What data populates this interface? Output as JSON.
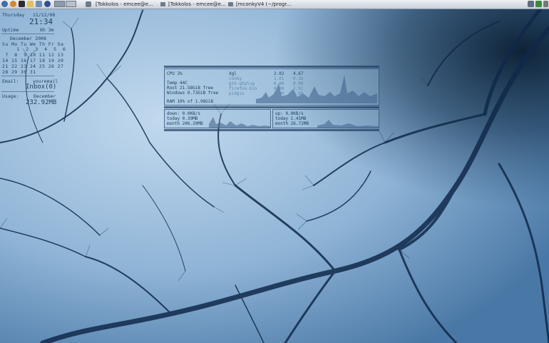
{
  "panel": {
    "tasks": [
      {
        "label": "[Tokkolos - emcee@e..."
      },
      {
        "label": "[Tokkolos - emcee@e..."
      },
      {
        "label": "[mconkyV4 (~/progr..."
      }
    ]
  },
  "conky_left": {
    "day": "Thursday",
    "date": "11/12/08",
    "time": "21:34",
    "uptime_label": "Uptime",
    "uptime_value": "6h 3m",
    "calendar": {
      "month": "December 2008",
      "header": "Su Mo Tu We Th Fr Sa",
      "weeks": [
        " 1  2  3  4  5  6",
        " 7  8  9 10 11 12 13",
        "14 15 16 17 18 19 20",
        "21 22 23 24 25 26 27",
        "28 29 30 31"
      ]
    },
    "email_label": "Email:",
    "email_account": "youremail",
    "inbox": "Inbox(0)",
    "usage_label": "Usage:",
    "usage_period": "December",
    "usage_value": "232.92MB"
  },
  "conky_center": {
    "system": {
      "cpu": "CPU 3%",
      "temp": "Temp 44C",
      "root": "Root 21.58GiB free",
      "windows": "Windows 0.73GiB free",
      "ram": "RAM 10% of 1.98GiB",
      "processes": [
        {
          "name": "Xgl",
          "cpu": "2.02",
          "mem": "4.67"
        },
        {
          "name": "conky",
          "cpu": "1.01",
          "mem": "0.16"
        },
        {
          "name": "gtk-qtplug",
          "cpu": "0.00",
          "mem": "0.00"
        },
        {
          "name": "firefox-bin",
          "cpu": "0.00",
          "mem": "2.91"
        },
        {
          "name": "pidgin",
          "cpu": "0.00",
          "mem": "0.00"
        }
      ]
    },
    "network_down": {
      "down": "down: 0.0KB/s",
      "today": "today 0.39MB",
      "month": "month 206.20MB"
    },
    "network_up": {
      "up": "up: 0.0KB/s",
      "today": "today 1.41MB",
      "month": "month 26.72MB"
    }
  },
  "colors": {
    "sky": "#a9c8e4",
    "tree": "#0f2740",
    "text": "#1f3e5e"
  }
}
